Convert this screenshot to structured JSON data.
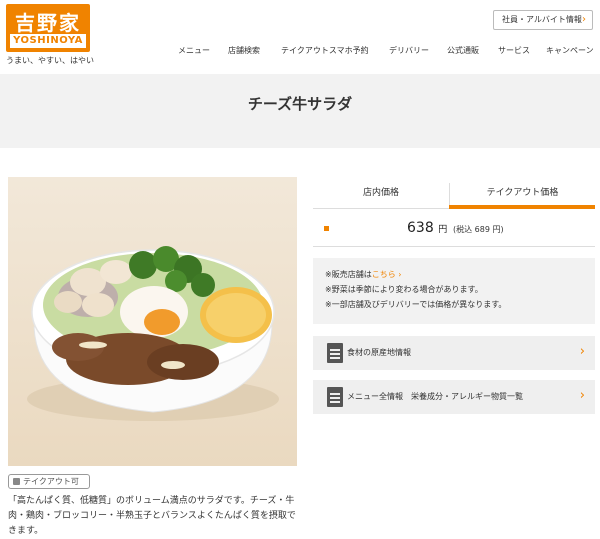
{
  "brand": {
    "logo_kanji": "吉野家",
    "logo_en": "YOSHINOYA",
    "tagline": "うまい、やすい、はやい",
    "accent_color": "#f08300"
  },
  "header": {
    "recruit_label": "社員・アルバイト情報",
    "nav": [
      "メニュー",
      "店舗検索",
      "テイクアウトスマホ予約",
      "デリバリー",
      "公式通販",
      "サービス",
      "キャンペーン"
    ]
  },
  "page": {
    "title": "チーズ牛サラダ"
  },
  "product": {
    "image_alt": "チーズ牛サラダ",
    "takeout_tag": "テイクアウト可",
    "description": "「高たんぱく質、低糖質」のボリューム満点のサラダです。チーズ・牛肉・鶏肉・ブロッコリー・半熟玉子とバランスよくたんぱく質を摂取できます。"
  },
  "price_panel": {
    "tabs": [
      {
        "label": "店内価格",
        "active": false
      },
      {
        "label": "テイクアウト価格",
        "active": true
      }
    ],
    "price": "638",
    "yen": "円",
    "tax_included": "(税込 689 円)",
    "notes": {
      "line1_prefix": "※販売店舗は",
      "line1_link": "こちら",
      "line2": "※野菜は季節により変わる場合があります。",
      "line3": "※一部店舗及びデリバリーでは価格が異なります。"
    }
  },
  "info_buttons": {
    "origin": "食材の原産地情報",
    "menu_info": "メニュー全情報　栄養成分・アレルギー物質一覧"
  },
  "icons": {
    "chevron": "chevron-right-icon",
    "document": "document-icon",
    "bag": "takeout-bag-icon"
  }
}
